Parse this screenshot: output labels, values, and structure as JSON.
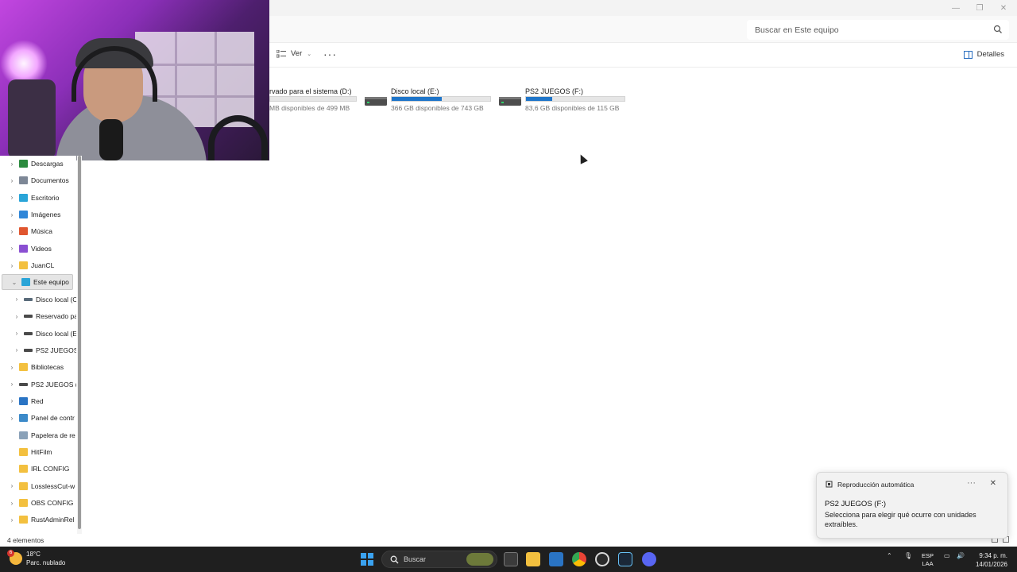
{
  "search": {
    "placeholder": "Buscar en Este equipo"
  },
  "commandbar": {
    "view_label": "Ver",
    "details_label": "Detalles"
  },
  "drives": [
    {
      "name": "rvado para el sistema (D:)",
      "free": "MB disponibles de 499 MB",
      "used_fraction": 0.0
    },
    {
      "name": "Disco local (E:)",
      "free": "366 GB disponibles de 743 GB",
      "used_fraction": 0.51
    },
    {
      "name": "PS2 JUEGOS (F:)",
      "free": "83,6 GB disponibles de 115 GB",
      "used_fraction": 0.27
    }
  ],
  "nav": {
    "items": [
      {
        "label": "Descargas",
        "icon": "download-icon",
        "color": "#2b8a3e"
      },
      {
        "label": "Documentos",
        "icon": "document-icon",
        "color": "#7d8796"
      },
      {
        "label": "Escritorio",
        "icon": "desktop-icon",
        "color": "#2aa5d8"
      },
      {
        "label": "Imágenes",
        "icon": "pictures-icon",
        "color": "#2f86d8"
      },
      {
        "label": "Música",
        "icon": "music-icon",
        "color": "#e0562f"
      },
      {
        "label": "Videos",
        "icon": "videos-icon",
        "color": "#8a4fd2"
      },
      {
        "label": "JuanCL",
        "icon": "folder-icon",
        "color": "#f3c03f"
      },
      {
        "label": "Este equipo",
        "icon": "computer-icon",
        "color": "#2aa5d8"
      },
      {
        "label": "Disco local (C",
        "icon": "drive-icon",
        "color": "#5a6b7a"
      },
      {
        "label": "Reservado pa",
        "icon": "drive-icon",
        "color": "#4a4a4a"
      },
      {
        "label": "Disco local (E",
        "icon": "drive-icon",
        "color": "#4a4a4a"
      },
      {
        "label": "PS2 JUEGOS (",
        "icon": "drive-icon",
        "color": "#4a4a4a"
      },
      {
        "label": "Bibliotecas",
        "icon": "folder-icon",
        "color": "#f3c03f"
      },
      {
        "label": "PS2 JUEGOS (F",
        "icon": "drive-icon",
        "color": "#4a4a4a"
      },
      {
        "label": "Red",
        "icon": "network-icon",
        "color": "#2a74c4"
      },
      {
        "label": "Panel de contr",
        "icon": "control-panel-icon",
        "color": "#3c8ac9"
      },
      {
        "label": "Papelera de re",
        "icon": "recycle-bin-icon",
        "color": "#8aa1b8"
      },
      {
        "label": "HitFilm",
        "icon": "folder-icon",
        "color": "#f3c03f"
      },
      {
        "label": "IRL CONFIG",
        "icon": "folder-icon",
        "color": "#f3c03f"
      },
      {
        "label": "LosslessCut-w",
        "icon": "folder-icon",
        "color": "#f3c03f"
      },
      {
        "label": "OBS CONFIG",
        "icon": "folder-icon",
        "color": "#f3c03f"
      },
      {
        "label": "RustAdminRel",
        "icon": "folder-icon",
        "color": "#f3c03f"
      }
    ]
  },
  "statusbar": {
    "count": "4 elementos"
  },
  "toast": {
    "app": "Reproducción automática",
    "title": "PS2 JUEGOS (F:)",
    "body": "Selecciona para elegir qué ocurre con unidades extraíbles."
  },
  "taskbar": {
    "weather_temp": "18°C",
    "weather_desc": "Parc. nublado",
    "weather_badge": "6",
    "search_label": "Buscar",
    "lang_top": "ESP",
    "lang_bottom": "LAA",
    "time": "9:34 p. m.",
    "date": "14/01/2026"
  },
  "colors": {
    "accent": "#1f75c9",
    "taskbar": "#1f1f1f"
  }
}
